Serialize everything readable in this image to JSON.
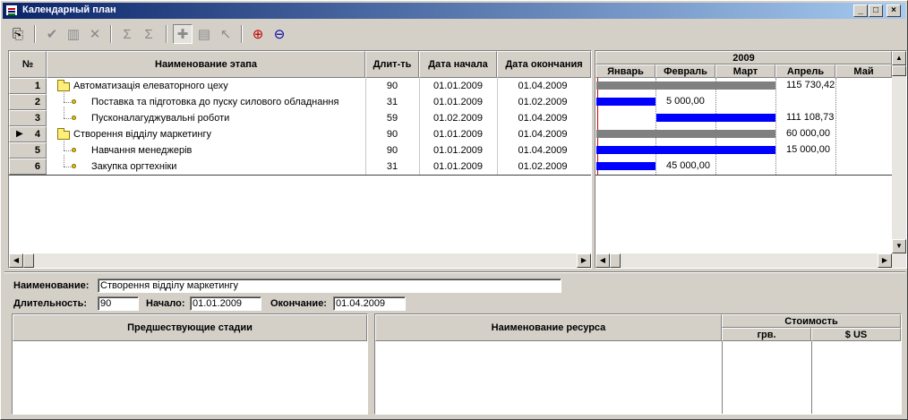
{
  "window": {
    "title": "Календарный план"
  },
  "toolbar": {
    "icons": [
      "export-icon",
      "check-icon",
      "chart-icon",
      "delete-icon",
      "sum-icon",
      "sum-alt-icon",
      "add-node-icon",
      "link-icon",
      "pointer-icon",
      "zoom-in-icon",
      "zoom-out-icon"
    ]
  },
  "grid": {
    "columns": [
      "№",
      "Наименование этапа",
      "Длит-ть",
      "Дата начала",
      "Дата окончания"
    ],
    "rows": [
      {
        "num": "1",
        "name": "Автоматизація елеваторного цеху",
        "dur": "90",
        "start": "01.01.2009",
        "end": "01.04.2009",
        "group": true,
        "current": false
      },
      {
        "num": "2",
        "name": "Поставка та підготовка до пуску силового обладнання",
        "dur": "31",
        "start": "01.01.2009",
        "end": "01.02.2009",
        "group": false,
        "current": false
      },
      {
        "num": "3",
        "name": "Пусконалагуджувальні роботи",
        "dur": "59",
        "start": "01.02.2009",
        "end": "01.04.2009",
        "group": false,
        "current": false
      },
      {
        "num": "4",
        "name": "Створення відділу маркетингу",
        "dur": "90",
        "start": "01.01.2009",
        "end": "01.04.2009",
        "group": true,
        "current": true
      },
      {
        "num": "5",
        "name": "Навчання менеджерів",
        "dur": "90",
        "start": "01.01.2009",
        "end": "01.04.2009",
        "group": false,
        "current": false
      },
      {
        "num": "6",
        "name": "Закупка оргтехніки",
        "dur": "31",
        "start": "01.01.2009",
        "end": "01.02.2009",
        "group": false,
        "current": false
      }
    ]
  },
  "gantt": {
    "year": "2009",
    "months": [
      "Январь",
      "Февраль",
      "Март",
      "Апрель",
      "Май"
    ],
    "bars": [
      {
        "label": "115 730,42",
        "color": "#808080"
      },
      {
        "label": "5 000,00",
        "color": "#0000ff"
      },
      {
        "label": "111 108,73",
        "color": "#0000ff"
      },
      {
        "label": "60 000,00",
        "color": "#808080"
      },
      {
        "label": "15 000,00",
        "color": "#0000ff"
      },
      {
        "label": "45 000,00",
        "color": "#0000ff"
      }
    ]
  },
  "details": {
    "name_label": "Наименование:",
    "name_value": "Створення відділу маркетингу",
    "duration_label": "Длительность:",
    "duration_value": "90",
    "start_label": "Начало:",
    "start_value": "01.01.2009",
    "end_label": "Окончание:",
    "end_value": "01.04.2009"
  },
  "pred": {
    "header": "Предшествующие стадии"
  },
  "res": {
    "header_name": "Наименование ресурса",
    "header_cost": "Стоимость",
    "header_uah": "грв.",
    "header_usd": "$ US"
  }
}
